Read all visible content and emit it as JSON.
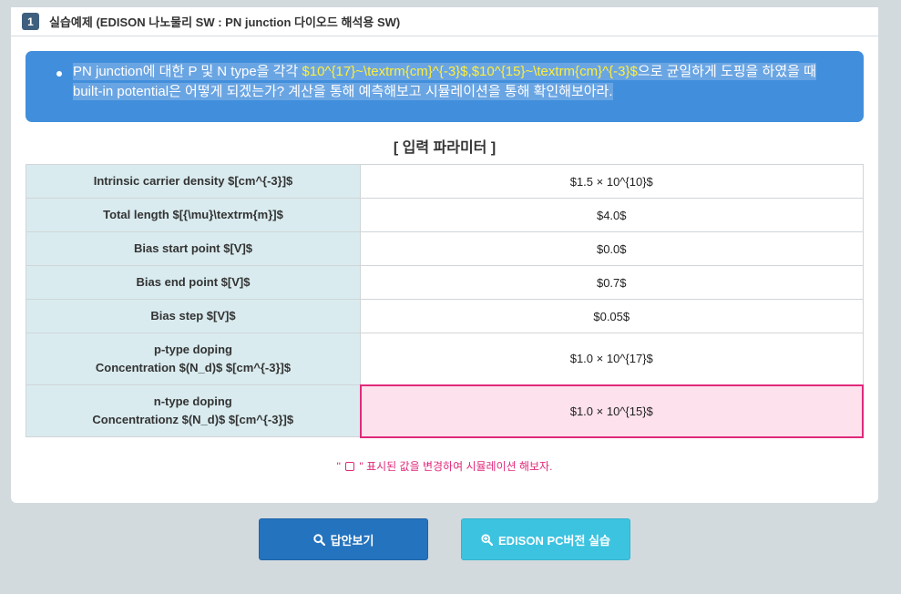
{
  "header": {
    "number": "1",
    "title": "실습예제 (EDISON 나노물리 SW : PN junction 다이오드 해석용 SW)"
  },
  "banner": {
    "text_a": "PN junction에 대한 P 및 N type을 각각 ",
    "text_b": "$10^{17}~\\textrm{cm}^{-3}$,$10^{15}~\\textrm{cm}^{-3}$",
    "text_c": "으로 균일하게 도핑을 하였을 때  built-in potential은 어떻게 되겠는가? 계산을 통해 예측해보고 시뮬레이션을 통해 확인해보아라."
  },
  "params": {
    "title": "[ 입력 파라미터 ]",
    "rows": [
      {
        "label": "Intrinsic carrier density $[cm^{-3}]$",
        "value": "$1.5 × 10^{10}$"
      },
      {
        "label": "Total length $[{\\mu}\\textrm{m}]$",
        "value": "$4.0$"
      },
      {
        "label": "Bias start point $[V]$",
        "value": "$0.0$"
      },
      {
        "label": "Bias end point $[V]$",
        "value": "$0.7$"
      },
      {
        "label": "Bias step $[V]$",
        "value": "$0.05$"
      },
      {
        "label_1": "p-type doping",
        "label_2": "Concentration $(N_d)$ $[cm^{-3}]$",
        "value": "$1.0 × 10^{17}$"
      },
      {
        "label_1": "n-type doping",
        "label_2": "Concentrationz $(N_d)$ $[cm^{-3}]$",
        "value": "$1.0 × 10^{15}$"
      }
    ]
  },
  "note": {
    "before": "\" ",
    "after": " \" 표시된 값을 변경하여 시뮬레이션 해보자."
  },
  "buttons": {
    "answer": "답안보기",
    "pc": "EDISON PC버전 실습"
  },
  "colors": {
    "banner": "#418fdc",
    "highlight_border": "#e0297b",
    "highlight_fill": "#fde1ec",
    "answer_button": "#2473be",
    "pc_button": "#3cc3e0"
  }
}
